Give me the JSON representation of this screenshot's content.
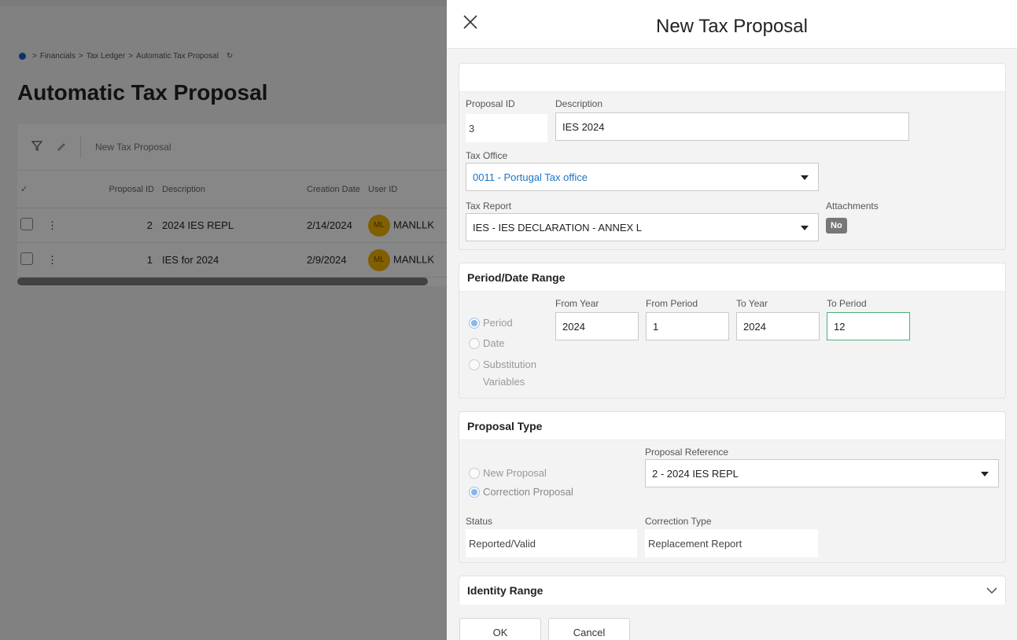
{
  "background": {
    "breadcrumb": [
      "Financials",
      "Tax Ledger",
      "Automatic Tax Proposal"
    ],
    "page_title": "Automatic Tax Proposal",
    "toolbar": {
      "new_label": "New Tax Proposal"
    },
    "columns": [
      "Proposal ID",
      "Description",
      "Creation Date",
      "User ID"
    ],
    "rows": [
      {
        "id": "2",
        "description": "2024 IES REPL",
        "date": "2/14/2024",
        "avatar": "ML",
        "user": "MANLLK"
      },
      {
        "id": "1",
        "description": "IES for 2024",
        "date": "2/9/2024",
        "avatar": "ML",
        "user": "MANLLK"
      }
    ]
  },
  "dialog": {
    "title": "New Tax Proposal",
    "general": {
      "proposal_id_label": "Proposal ID",
      "proposal_id": "3",
      "description_label": "Description",
      "description": "IES 2024",
      "tax_office_label": "Tax Office",
      "tax_office": "0011 - Portugal Tax office",
      "tax_report_label": "Tax Report",
      "tax_report": "IES - IES DECLARATION - ANNEX L",
      "attachments_label": "Attachments",
      "attachments": "No"
    },
    "period": {
      "title": "Period/Date Range",
      "options": [
        "Period",
        "Date",
        "Substitution Variables"
      ],
      "from_year_label": "From Year",
      "from_year": "2024",
      "from_period_label": "From Period",
      "from_period": "1",
      "to_year_label": "To Year",
      "to_year": "2024",
      "to_period_label": "To Period",
      "to_period": "12"
    },
    "proposal_type": {
      "title": "Proposal Type",
      "options": [
        "New Proposal",
        "Correction Proposal"
      ],
      "reference_label": "Proposal Reference",
      "reference": "2 - 2024 IES REPL",
      "status_label": "Status",
      "status": "Reported/Valid",
      "correction_type_label": "Correction Type",
      "correction_type": "Replacement Report"
    },
    "identity_range": {
      "title": "Identity Range"
    },
    "buttons": {
      "ok": "OK",
      "cancel": "Cancel"
    }
  }
}
